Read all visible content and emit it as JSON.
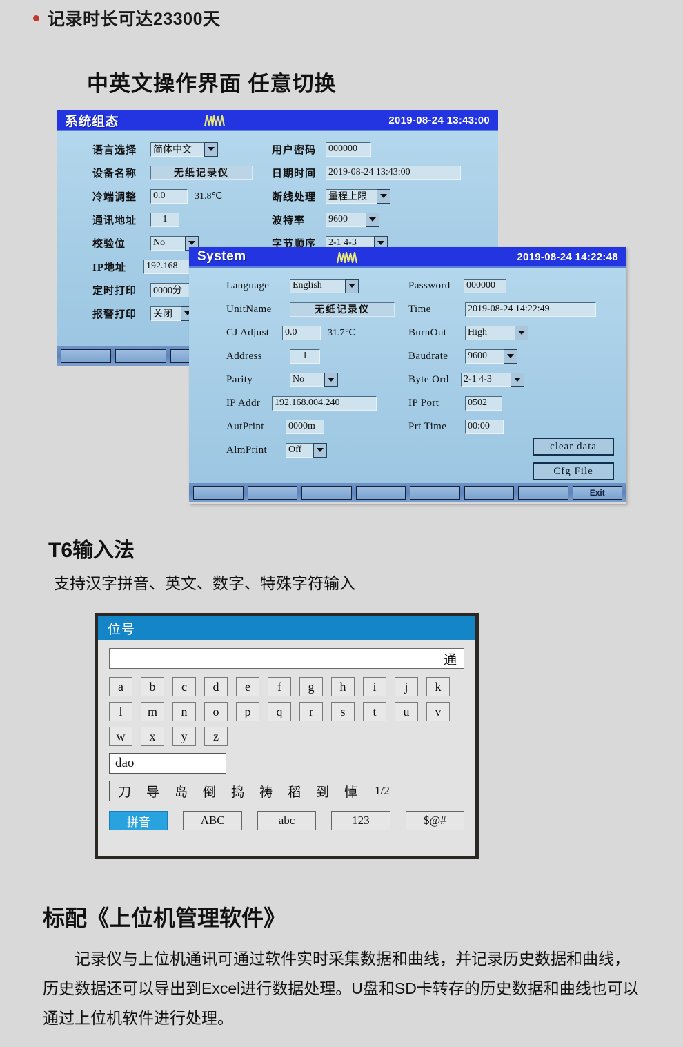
{
  "top_bullet": {
    "text": "记录时长可达23300天"
  },
  "heading_language": "中英文操作界面  任意切换",
  "dialog_cn": {
    "title": "系统组态",
    "logo": "wave-logo",
    "datetime": "2019-08-24 13:43:00",
    "fields_left": [
      {
        "label": "语言选择",
        "value": "简体中文",
        "type": "combo"
      },
      {
        "label": "设备名称",
        "value": "无纸记录仪",
        "type": "text"
      },
      {
        "label": "冷端调整",
        "value": "0.0",
        "unit": "31.8℃",
        "type": "text"
      },
      {
        "label": "通讯地址",
        "value": "1",
        "type": "text"
      },
      {
        "label": "校验位",
        "value": "No",
        "type": "combo"
      },
      {
        "label": "IP地址",
        "value": "192.168",
        "type": "text"
      },
      {
        "label": "定时打印",
        "value": "0000分",
        "type": "text"
      },
      {
        "label": "报警打印",
        "value": "关闭",
        "type": "combo"
      }
    ],
    "fields_right": [
      {
        "label": "用户密码",
        "value": "000000",
        "type": "text"
      },
      {
        "label": "日期时间",
        "value": "2019-08-24  13:43:00",
        "type": "text"
      },
      {
        "label": "断线处理",
        "value": "量程上限",
        "type": "combo"
      },
      {
        "label": "波特率",
        "value": "9600",
        "type": "combo"
      },
      {
        "label": "字节顺序",
        "value": "2-1 4-3",
        "type": "combo"
      }
    ]
  },
  "dialog_en": {
    "title": "System",
    "logo": "wave-logo",
    "datetime": "2019-08-24 14:22:48",
    "fields_left": [
      {
        "label": "Language",
        "value": "English",
        "type": "combo"
      },
      {
        "label": "UnitName",
        "value": "无纸记录仪",
        "type": "text"
      },
      {
        "label": "CJ Adjust",
        "value": "0.0",
        "unit": "31.7℃",
        "type": "text"
      },
      {
        "label": "Address",
        "value": "1",
        "type": "text"
      },
      {
        "label": "Parity",
        "value": "No",
        "type": "combo"
      },
      {
        "label": "IP Addr",
        "value": "192.168.004.240",
        "type": "text"
      },
      {
        "label": "AutPrint",
        "value": "0000m",
        "type": "text"
      },
      {
        "label": "AlmPrint",
        "value": "Off",
        "type": "combo"
      }
    ],
    "fields_right": [
      {
        "label": "Password",
        "value": "000000",
        "type": "text"
      },
      {
        "label": "Time",
        "value": "2019-08-24  14:22:49",
        "type": "text"
      },
      {
        "label": "BurnOut",
        "value": "High",
        "type": "combo"
      },
      {
        "label": "Baudrate",
        "value": "9600",
        "type": "combo"
      },
      {
        "label": "Byte Ord",
        "value": "2-1 4-3",
        "type": "combo"
      },
      {
        "label": "IP Port",
        "value": "0502",
        "type": "text"
      },
      {
        "label": "Prt Time",
        "value": "00:00",
        "type": "text"
      }
    ],
    "buttons": [
      {
        "label": "clear data"
      },
      {
        "label": "Cfg File"
      }
    ],
    "footer_keys": [
      "",
      "",
      "",
      "",
      "",
      "",
      "",
      "Exit"
    ]
  },
  "t6": {
    "title": "T6输入法",
    "subtitle": "支持汉字拼音、英文、数字、特殊字符输入"
  },
  "keyboard": {
    "title": "位号",
    "display_value": "通",
    "rows": [
      [
        "a",
        "b",
        "c",
        "d",
        "e",
        "f",
        "g",
        "h",
        "i",
        "j",
        "k"
      ],
      [
        "l",
        "m",
        "n",
        "o",
        "p",
        "q",
        "r",
        "s",
        "t",
        "u",
        "v"
      ],
      [
        "w",
        "x",
        "y",
        "z"
      ]
    ],
    "pinyin_value": "dao",
    "candidates": [
      "刀",
      "导",
      "岛",
      "倒",
      "捣",
      "祷",
      "稻",
      "到",
      "悼"
    ],
    "page": "1/2",
    "modes": [
      {
        "label": "拼音",
        "active": true
      },
      {
        "label": "ABC",
        "active": false
      },
      {
        "label": "abc",
        "active": false
      },
      {
        "label": "123",
        "active": false
      },
      {
        "label": "$@#",
        "active": false
      }
    ]
  },
  "software": {
    "title": "标配《上位机管理软件》",
    "paragraph": "记录仪与上位机通讯可通过软件实时采集数据和曲线，并记录历史数据和曲线，历史数据还可以导出到Excel进行数据处理。U盘和SD卡转存的历史数据和曲线也可以通过上位机软件进行处理。"
  },
  "colors": {
    "page_bg": "#d9d9d9",
    "titlebar_blue": "#2335e0",
    "dialog_body": "#a6cde6",
    "kbd_title_blue": "#1486c8",
    "accent_cyan": "#29a3e0",
    "bullet_red": "#c0392b"
  }
}
